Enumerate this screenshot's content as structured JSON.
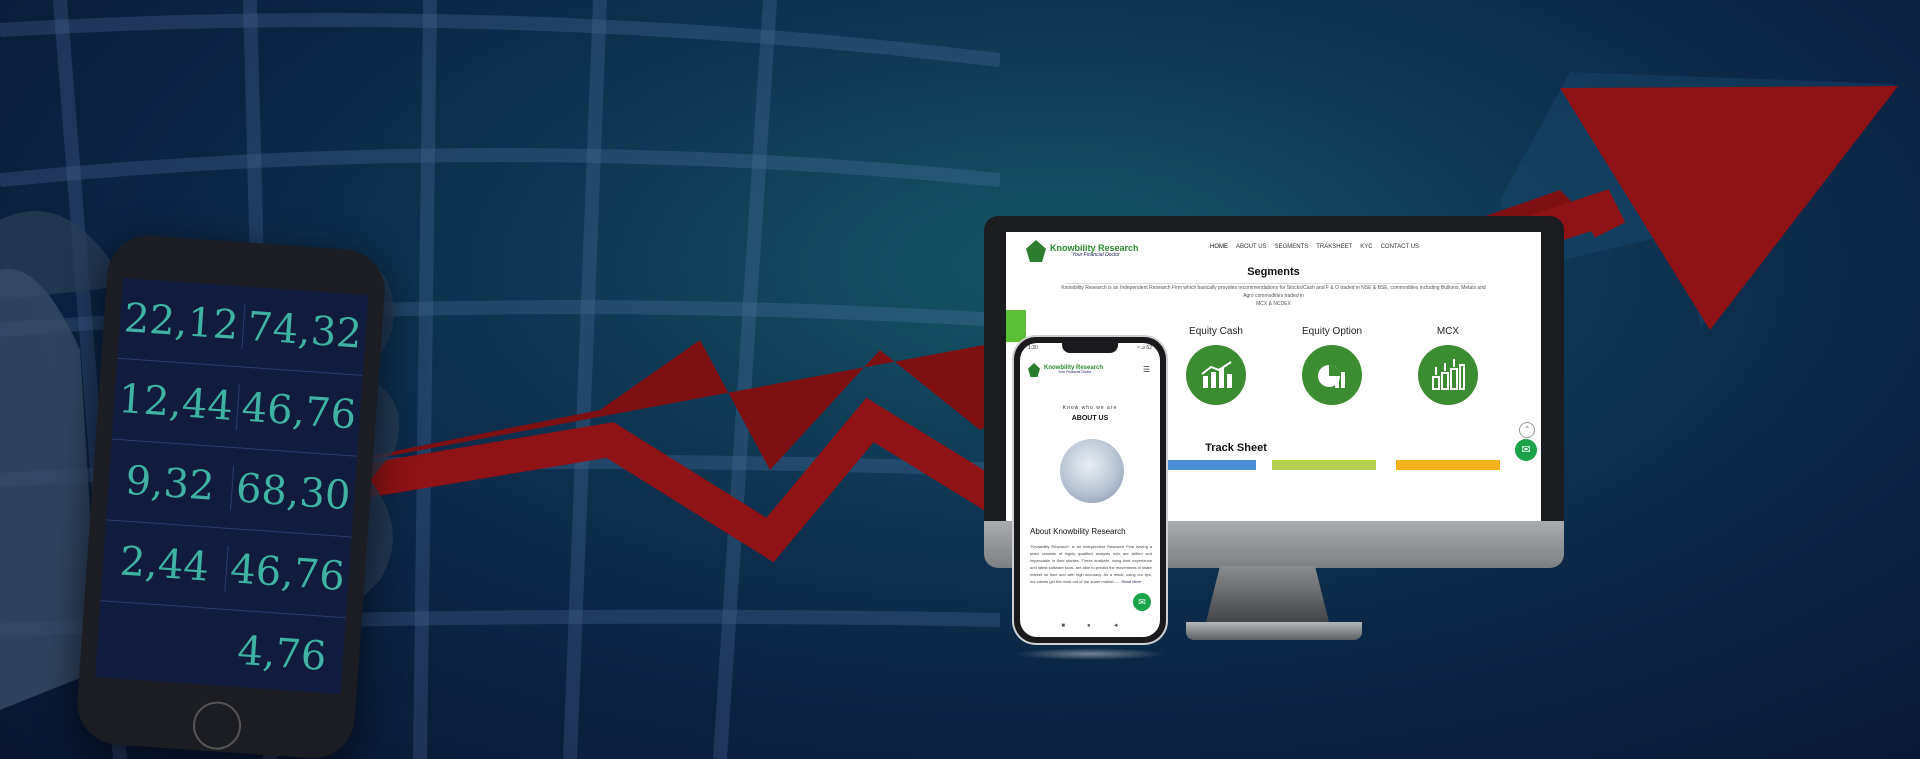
{
  "hand_phone": {
    "rows": [
      [
        "22,12",
        "74,32"
      ],
      [
        "12,44",
        "46,76"
      ],
      [
        "9,32",
        "68,30"
      ],
      [
        "2,44",
        "46,76"
      ],
      [
        "",
        "4,76"
      ]
    ]
  },
  "website": {
    "logo": {
      "name": "Knowbility Research",
      "tagline": "Your Financial Doctor"
    },
    "nav": [
      "HOME",
      "ABOUT US",
      "SEGMENTS",
      "TRAKSHEET",
      "KYC",
      "CONTACT US"
    ],
    "segments": {
      "title": "Segments",
      "description_1": "Knowbility Research is an Independent Research Firm which basically provides recommendations for Stocks/Cash and F & O traded in NSE & BSE, commodities including Bullions, Metals and Agro commodities traded in",
      "description_2": "MCX & NCDEX",
      "items": [
        {
          "label": "Equity Cash",
          "icon": "bar-chart-icon"
        },
        {
          "label": "Equity Option",
          "icon": "pie-chart-icon"
        },
        {
          "label": "MCX",
          "icon": "growth-bars-icon"
        }
      ]
    },
    "track_sheet": {
      "title": "Track Sheet",
      "bar_colors": [
        "#4a8fd8",
        "#b5d14e",
        "#f4b11c"
      ]
    }
  },
  "mobile": {
    "status_left": "1:30",
    "status_right": "⁸ ⊿ 62",
    "kicker": "Know who we are",
    "about_title": "ABOUT US",
    "heading": "About Knowbility Research",
    "body": "\"Knowbility Research\" is an Independent Research Firm having a team consists of highly qualified analysts who are skilled and impeccable in their stadies. These analysts, using their experience and latest software tools, are able to predict the movements in share market on time and with high accuracy. As a result, using our tips, our clients get the most out of the share market......",
    "read_more": "Read More",
    "nav_icons": [
      "■",
      "●",
      "◄"
    ]
  },
  "colors": {
    "arrow_red": "#8e1216",
    "brand_green": "#2c8a30",
    "mail_green": "#1ba34a"
  }
}
